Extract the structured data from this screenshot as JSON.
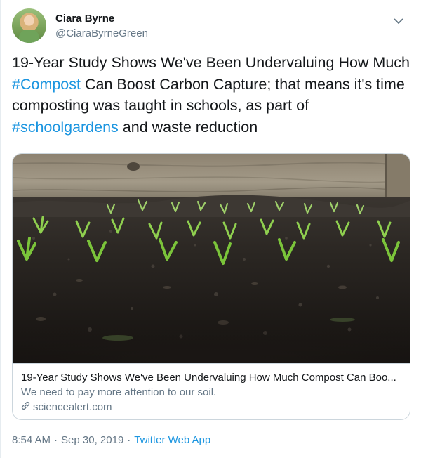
{
  "author": {
    "name": "Ciara Byrne",
    "handle": "@CiaraByrneGreen"
  },
  "menu": {
    "icon": "chevron-down-icon"
  },
  "tweet": {
    "text_1": "19-Year Study Shows We've Been Undervaluing How Much ",
    "hashtag_1": "#Compost",
    "text_2": " Can Boost Carbon Capture; that means it's time composting was taught in schools, as part of ",
    "hashtag_2": "#schoolgardens",
    "text_3": " and waste reduction"
  },
  "card": {
    "image": "seedlings-in-soil-photo",
    "title": "19-Year Study Shows We've Been Undervaluing How Much Compost Can Boo...",
    "description": "We need to pay more attention to our soil.",
    "domain": "sciencealert.com",
    "domain_icon": "link-icon"
  },
  "footer": {
    "time": "8:54 AM",
    "separator_1": "·",
    "date": "Sep 30, 2019",
    "separator_2": "·",
    "source": "Twitter Web App"
  },
  "colors": {
    "link": "#1b95e0",
    "text": "#14171a",
    "secondary": "#657786",
    "border": "#ccd6dd"
  }
}
